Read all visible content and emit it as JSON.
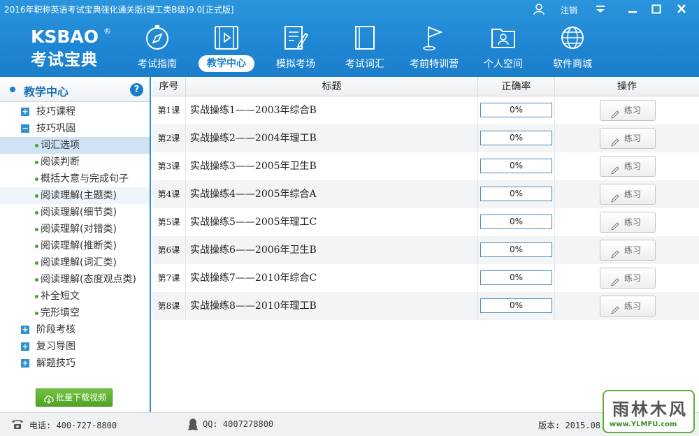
{
  "window": {
    "title": "2016年职称英语考试宝典强化通关版(理工类B级)9.0[正式版]",
    "logout_label": "注销"
  },
  "logo": {
    "en": "KSBAO",
    "reg": "®",
    "cn": "考试宝典"
  },
  "nav": [
    {
      "label": "考试指南",
      "icon": "compass-icon",
      "active": false
    },
    {
      "label": "教学中心",
      "icon": "video-icon",
      "active": true
    },
    {
      "label": "模拟考场",
      "icon": "exam-paper-icon",
      "active": false
    },
    {
      "label": "考试词汇",
      "icon": "book-icon",
      "active": false
    },
    {
      "label": "考前特训营",
      "icon": "flag-icon",
      "active": false
    },
    {
      "label": "个人空间",
      "icon": "user-folder-icon",
      "active": false
    },
    {
      "label": "软件商城",
      "icon": "globe-icon",
      "active": false
    }
  ],
  "sidebar": {
    "title": "教学中心",
    "help": "?",
    "tree": [
      {
        "type": "group",
        "sign": "+",
        "label": "技巧课程"
      },
      {
        "type": "group",
        "sign": "−",
        "label": "技巧巩固"
      },
      {
        "type": "leaf",
        "label": "词汇选项",
        "selected": true
      },
      {
        "type": "leaf",
        "label": "阅读判断"
      },
      {
        "type": "leaf",
        "label": "概括大意与完成句子"
      },
      {
        "type": "leaf",
        "label": "阅读理解(主题类)",
        "hover": true
      },
      {
        "type": "leaf",
        "label": "阅读理解(细节类)"
      },
      {
        "type": "leaf",
        "label": "阅读理解(对错类)"
      },
      {
        "type": "leaf",
        "label": "阅读理解(推断类)"
      },
      {
        "type": "leaf",
        "label": "阅读理解(词汇类)"
      },
      {
        "type": "leaf",
        "label": "阅读理解(态度观点类)"
      },
      {
        "type": "leaf",
        "label": "补全短文"
      },
      {
        "type": "leaf",
        "label": "完形填空"
      },
      {
        "type": "group",
        "sign": "+",
        "label": "阶段考核"
      },
      {
        "type": "group",
        "sign": "+",
        "label": "复习导图"
      },
      {
        "type": "group",
        "sign": "+",
        "label": "解题技巧"
      }
    ],
    "download_label": "批量下载视频"
  },
  "table": {
    "headers": {
      "num": "序号",
      "title": "标题",
      "rate": "正确率",
      "op": "操作"
    },
    "practice_label": "练习",
    "rows": [
      {
        "num": "第1课",
        "title": "实战操练1——2003年综合B",
        "rate": "0%"
      },
      {
        "num": "第2课",
        "title": "实战操练2——2004年理工B",
        "rate": "0%"
      },
      {
        "num": "第3课",
        "title": "实战操练3——2005年卫生B",
        "rate": "0%"
      },
      {
        "num": "第4课",
        "title": "实战操练4——2005年综合A",
        "rate": "0%"
      },
      {
        "num": "第5课",
        "title": "实战操练5——2005年理工C",
        "rate": "0%"
      },
      {
        "num": "第6课",
        "title": "实战操练6——2006年卫生B",
        "rate": "0%"
      },
      {
        "num": "第7课",
        "title": "实战操练7——2010年综合C",
        "rate": "0%"
      },
      {
        "num": "第8课",
        "title": "实战操练8——2010年理工B",
        "rate": "0%"
      }
    ]
  },
  "footer": {
    "phone": "电话: 400-727-8800",
    "qq": "QQ: 4007278800",
    "version": "版本: 2015.08."
  },
  "watermark": {
    "cn": "雨林木风",
    "url": "www.YLMFU.com"
  },
  "colors": {
    "accent": "#1f86d3",
    "green": "#4fa424"
  }
}
